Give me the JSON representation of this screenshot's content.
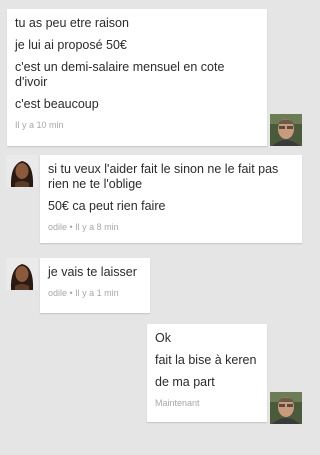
{
  "messages": [
    {
      "sender": "other",
      "lines": [
        "tu as peu etre raison",
        "je lui ai proposé 50€",
        "c'est un demi-salaire mensuel en cote d'ivoir",
        "c'est beaucoup"
      ],
      "meta": "Il y a 10 min"
    },
    {
      "sender": "odile",
      "lines": [
        "si tu veux l'aider fait le  sinon ne le fait pas rien ne te l'oblige",
        "50€ ca peut rien faire"
      ],
      "meta": "odile • Il y a 8 min"
    },
    {
      "sender": "odile",
      "lines": [
        "je vais te laisser"
      ],
      "meta": "odile • Il y a 1 min"
    },
    {
      "sender": "other",
      "lines": [
        "Ok",
        "fait la bise à keren",
        "de ma part"
      ],
      "meta": "Maintenant"
    }
  ],
  "avatars": {
    "man": "man-avatar",
    "odile": "odile-avatar"
  },
  "colors": {
    "background": "#e5e5e5",
    "bubble": "#ffffff",
    "text": "#2b2b2b",
    "meta": "#a7a7a7"
  }
}
